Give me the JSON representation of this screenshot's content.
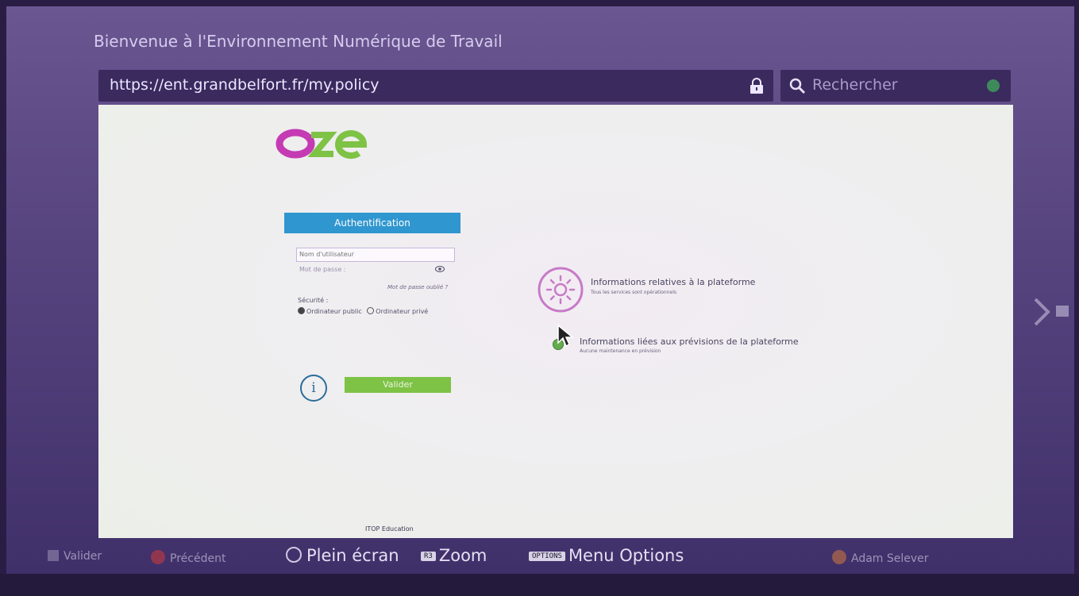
{
  "browser": {
    "page_title": "Bienvenue à l'Environnement Numérique de Travail",
    "url": "https://ent.grandbelfort.fr/my.policy",
    "search_placeholder": "Rechercher"
  },
  "login": {
    "logo_text": "oze",
    "header": "Authentification",
    "username_placeholder": "Nom d'utilisateur",
    "password_label": "Mot de passe :",
    "forgot_password": "Mot de passe oublié ?",
    "security_label": "Sécurité :",
    "option_public": "Ordinateur public",
    "option_private": "Ordinateur privé",
    "selected_option": "Ordinateur public",
    "info_icon_glyph": "i",
    "validate_button": "Valider"
  },
  "platform_info": {
    "title": "Informations relatives à la plateforme",
    "status": "Tous les services sont opérationnels"
  },
  "forecast_info": {
    "title": "Informations liées aux prévisions de la plateforme",
    "status": "Aucune maintenance en prévision"
  },
  "footer": {
    "partner_text": "ITOP Education"
  },
  "controller_bar": {
    "select": "Valider",
    "back": "Précédent",
    "fullscreen": "Plein écran",
    "zoom_key": "R3",
    "zoom": "Zoom",
    "options_key": "OPTIONS",
    "options": "Menu Options",
    "user": "Adam Selever"
  },
  "colors": {
    "auth_header": "#2f96cf",
    "validate_button": "#7ec246",
    "logo_pink": "#c43bb3",
    "logo_green": "#7ec246",
    "platform_icon": "#c87ac8"
  }
}
